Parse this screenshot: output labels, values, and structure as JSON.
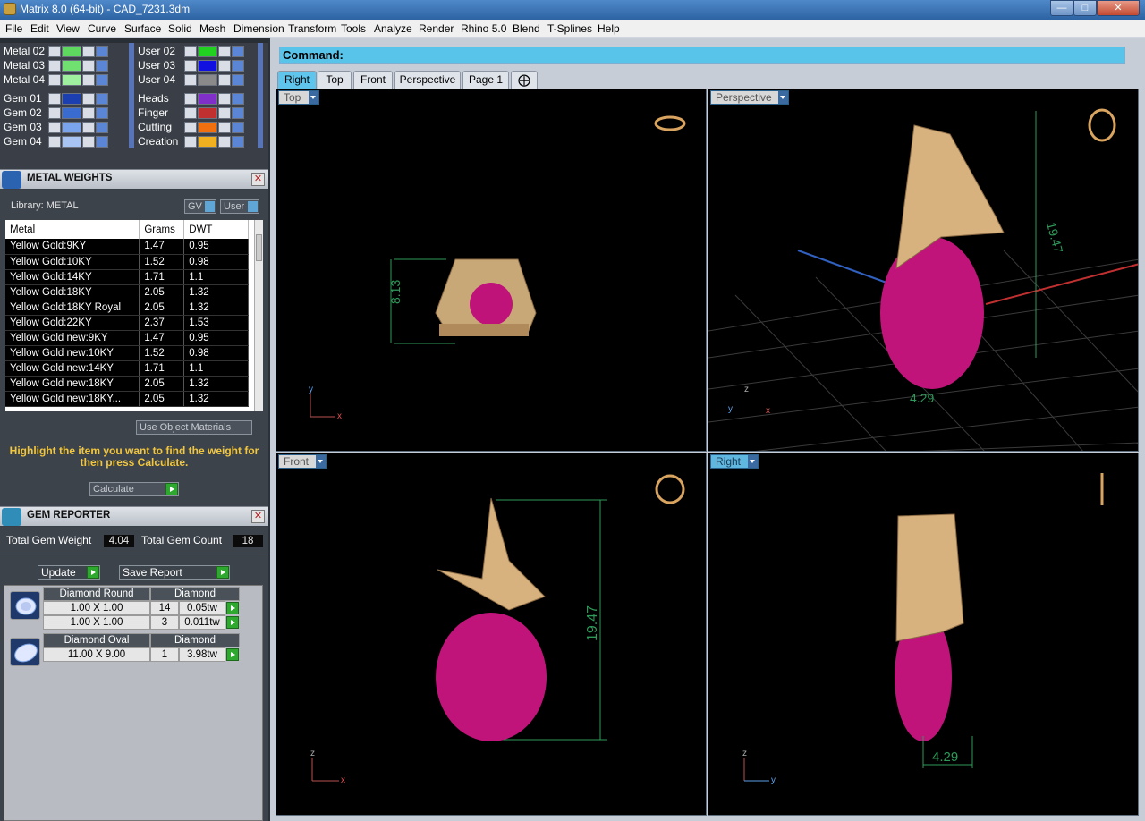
{
  "window": {
    "title": "Matrix 8.0 (64-bit) - CAD_7231.3dm"
  },
  "menu": [
    "File",
    "Edit",
    "View",
    "Curve",
    "Surface",
    "Solid",
    "Mesh",
    "Dimension",
    "Transform",
    "Tools",
    "Analyze",
    "Render",
    "Rhino 5.0",
    "Blend",
    "T-Splines",
    "Help"
  ],
  "layers": {
    "left": [
      {
        "name": "Metal 02",
        "color": "#5ed85e"
      },
      {
        "name": "Metal 03",
        "color": "#70e070"
      },
      {
        "name": "Metal 04",
        "color": "#9ef09e"
      },
      {
        "name": "Gem 01",
        "color": "#1c3fb0"
      },
      {
        "name": "Gem 02",
        "color": "#3a6cd0"
      },
      {
        "name": "Gem 03",
        "color": "#7aa4ec"
      },
      {
        "name": "Gem 04",
        "color": "#a8c4f2"
      }
    ],
    "right": [
      {
        "name": "User 02",
        "color": "#22d022"
      },
      {
        "name": "User 03",
        "color": "#1010e0"
      },
      {
        "name": "User 04",
        "color": "#8a8a8a"
      },
      {
        "name": "Heads",
        "color": "#8030c8"
      },
      {
        "name": "Finger",
        "color": "#c03030"
      },
      {
        "name": "Cutting",
        "color": "#f07010"
      },
      {
        "name": "Creation",
        "color": "#f0b020"
      }
    ]
  },
  "metal_weights": {
    "title": "METAL WEIGHTS",
    "library": "Library: METAL",
    "gv": "GV",
    "user": "User",
    "columns": [
      "Metal",
      "Grams",
      "DWT"
    ],
    "rows": [
      [
        "Yellow Gold:9KY",
        "1.47",
        "0.95"
      ],
      [
        "Yellow Gold:10KY",
        "1.52",
        "0.98"
      ],
      [
        "Yellow Gold:14KY",
        "1.71",
        "1.1"
      ],
      [
        "Yellow Gold:18KY",
        "2.05",
        "1.32"
      ],
      [
        "Yellow Gold:18KY Royal",
        "2.05",
        "1.32"
      ],
      [
        "Yellow Gold:22KY",
        "2.37",
        "1.53"
      ],
      [
        "Yellow Gold new:9KY",
        "1.47",
        "0.95"
      ],
      [
        "Yellow Gold new:10KY",
        "1.52",
        "0.98"
      ],
      [
        "Yellow Gold new:14KY",
        "1.71",
        "1.1"
      ],
      [
        "Yellow Gold new:18KY",
        "2.05",
        "1.32"
      ],
      [
        "Yellow Gold new:18KY...",
        "2.05",
        "1.32"
      ]
    ],
    "use_object_materials": "Use Object Materials",
    "hint": "Highlight the item you want to find the weight for then press Calculate.",
    "calculate": "Calculate"
  },
  "gem_reporter": {
    "title": "GEM REPORTER",
    "total_weight_label": "Total Gem Weight",
    "total_weight": "4.04",
    "total_count_label": "Total Gem Count",
    "total_count": "18",
    "update": "Update",
    "save_report": "Save Report",
    "groups": [
      {
        "name": "Diamond Round",
        "material": "Diamond",
        "rows": [
          [
            "1.00 X 1.00",
            "14",
            "0.05tw"
          ],
          [
            "1.00 X 1.00",
            "3",
            "0.011tw"
          ]
        ]
      },
      {
        "name": "Diamond Oval",
        "material": "Diamond",
        "rows": [
          [
            "11.00 X 9.00",
            "1",
            "3.98tw"
          ]
        ]
      }
    ]
  },
  "command": {
    "label": "Command:"
  },
  "tabs": [
    "Right",
    "Top",
    "Front",
    "Perspective",
    "Page 1"
  ],
  "viewports": {
    "top": {
      "label": "Top",
      "dim": "8.13"
    },
    "perspective": {
      "label": "Perspective",
      "dim_a": "19.47",
      "dim_b": "4.29"
    },
    "front": {
      "label": "Front",
      "dim": "19.47"
    },
    "right": {
      "label": "Right",
      "dim": "4.29"
    }
  },
  "axes": {
    "x": "x",
    "y": "y",
    "z": "z"
  }
}
